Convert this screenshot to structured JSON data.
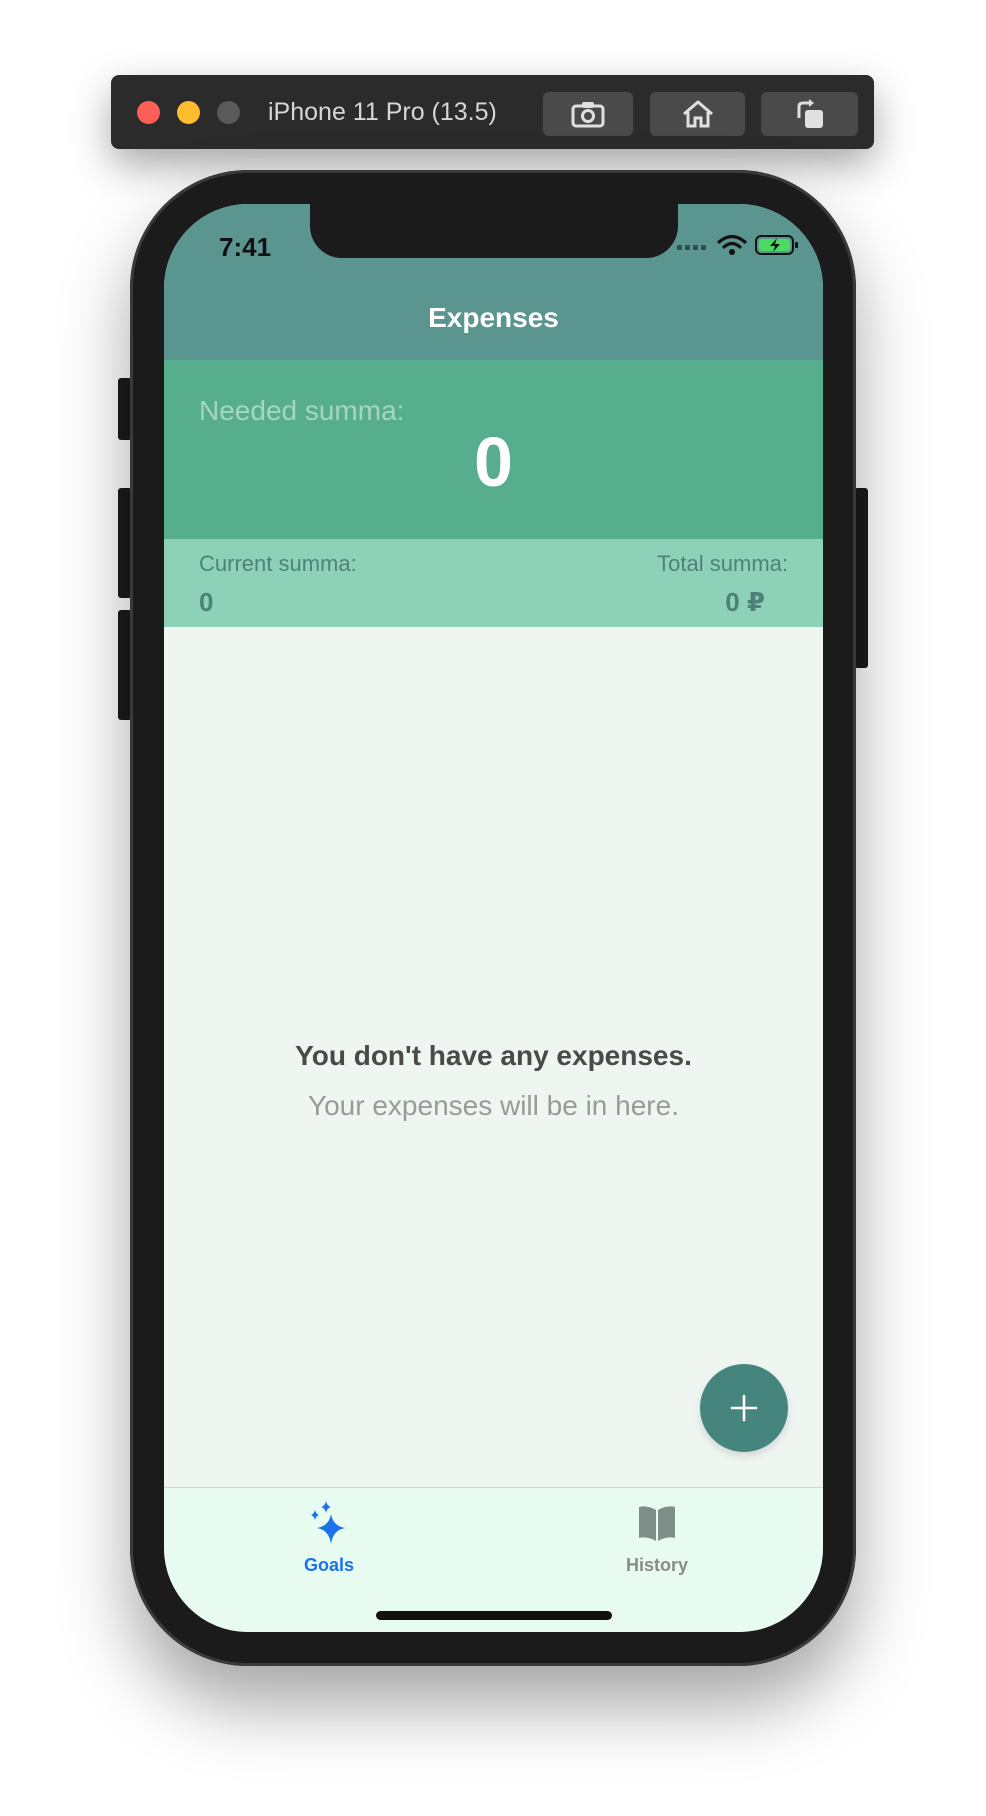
{
  "simulator": {
    "title": "iPhone 11 Pro (13.5)",
    "buttons": [
      "screenshot-icon",
      "home-icon",
      "rotate-icon"
    ]
  },
  "status_bar": {
    "time": "7:41"
  },
  "nav": {
    "title": "Expenses"
  },
  "needed": {
    "label": "Needed summa:",
    "value": "0"
  },
  "current": {
    "label": "Current summa:",
    "value": "0"
  },
  "total": {
    "label": "Total summa:",
    "value": "0 ₽"
  },
  "empty_state": {
    "title": "You don't have any expenses.",
    "subtitle": "Your expenses will be in here."
  },
  "tabs": [
    {
      "label": "Goals",
      "icon": "sparkles-icon",
      "selected": true
    },
    {
      "label": "History",
      "icon": "book-icon",
      "selected": false
    }
  ],
  "colors": {
    "nav_bg": "#5a9590",
    "needed_bg": "#56ae8f",
    "sums_bg": "#8dd2b8",
    "fab": "#45857e",
    "tab_selected": "#1a73e8",
    "content_bg": "#eff5f0"
  }
}
